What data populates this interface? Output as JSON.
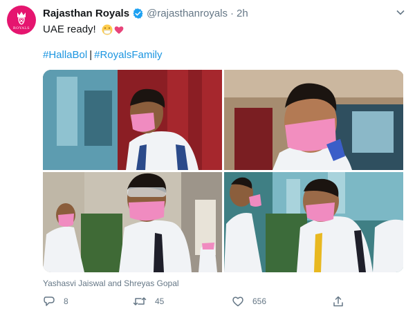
{
  "tweet": {
    "avatar": {
      "brand_text": "ROYALS",
      "brand_color": "#e5156f"
    },
    "author_name": "Rajasthan Royals",
    "handle": "@rajasthanroyals",
    "separator": "·",
    "time": "2h",
    "text": "UAE ready!",
    "emojis": [
      "mask-face-emoji",
      "pink-heart-emoji"
    ],
    "hashtags": [
      "#HallaBol",
      "#RoyalsFamily"
    ],
    "hashtag_separator": "|",
    "media_caption": "Yashasvi Jaiswal and Shreyas Gopal",
    "actions": {
      "replies": "8",
      "retweets": "45",
      "likes": "656"
    },
    "colors": {
      "link": "#1b95e0",
      "verified": "#1da1f2",
      "muted": "#657786"
    }
  }
}
